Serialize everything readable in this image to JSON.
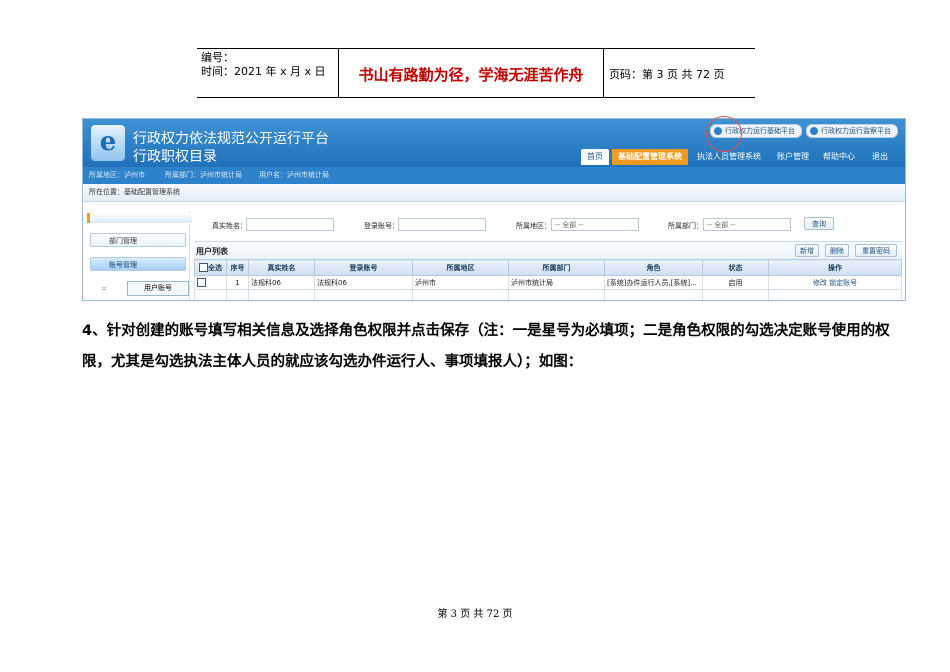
{
  "doc_header": {
    "number_label": "编号：",
    "date_label": "时间：2021 年 x 月 x 日",
    "motto": "书山有路勤为径，学海无涯苦作舟",
    "page_label": "页码：第 3 页  共 72 页"
  },
  "app": {
    "title_line1": "行政权力依法规范公开运行平台",
    "title_line2": "行政职权目录",
    "logo_letter": "e",
    "top_links": [
      "行政权力运行基础平台",
      "行政权力运行监察平台"
    ],
    "nav": [
      "首页",
      "基础配置管理系统",
      "执法人员管理系统",
      "账户管理",
      "帮助中心",
      "退出"
    ],
    "info": {
      "region": "所属地区：泸州市",
      "dept": "所属部门：泸州市统计局",
      "user": "用户名：泸州市统计局"
    },
    "position": "所在位置：基础配置管理系统",
    "sidebar": {
      "items": [
        "部门管理",
        "账号管理"
      ],
      "sub_item": "用户账号"
    },
    "search": {
      "realname_label": "真实姓名：",
      "login_label": "登录账号：",
      "region_label": "所属地区：",
      "region_value": "-- 全部 --",
      "dept_label": "所属部门：",
      "dept_value": "-- 全部 --",
      "query_button": "查询"
    },
    "list": {
      "title": "用户列表",
      "add_button": "新增",
      "delete_button": "删除",
      "reset_button": "重置密码",
      "columns": [
        "全选",
        "序号",
        "真实姓名",
        "登录账号",
        "所属地区",
        "所属部门",
        "角色",
        "状态",
        "操作"
      ],
      "rows": [
        [
          "",
          "1",
          "法规科06",
          "法规科06",
          "泸州市",
          "泸州市统计局",
          "[系统]办件运行人员,[系统]...",
          "启用",
          "修改  锁定账号"
        ]
      ]
    }
  },
  "body_text": "4、针对创建的账号填写相关信息及选择角色权限并点击保存（注：一是星号为必填项；二是角色权限的勾选决定账号使用的权限，尤其是勾选执法主体人员的就应该勾选办件运行人、事项填报人）；如图：",
  "footer": "第 3 页 共 72 页"
}
